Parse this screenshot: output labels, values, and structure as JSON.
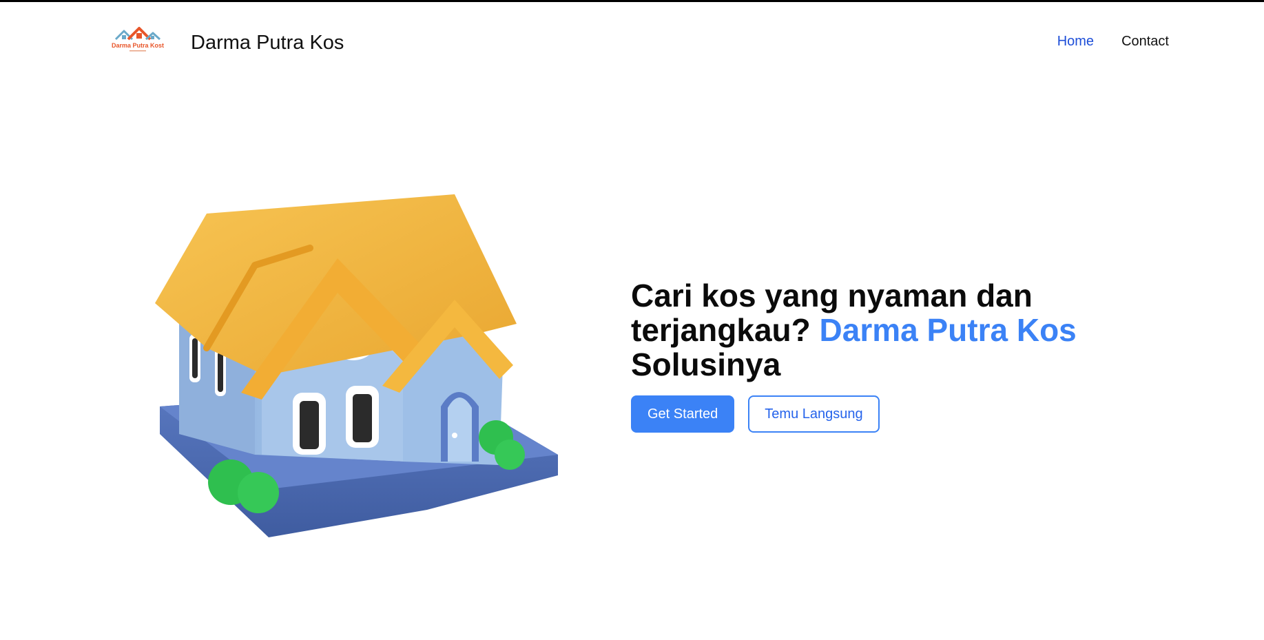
{
  "header": {
    "brand_name": "Darma Putra Kos",
    "logo_text": "Darma Putra Kost",
    "nav": [
      {
        "label": "Home",
        "active": true
      },
      {
        "label": "Contact",
        "active": false
      }
    ]
  },
  "hero": {
    "headline_part1": "Cari kos yang nyaman dan terjangkau?",
    "headline_accent": "Darma Putra Kos",
    "headline_part2": "Solusinya",
    "primary_cta": "Get Started",
    "secondary_cta": "Temu Langsung"
  },
  "colors": {
    "accent": "#3b82f6",
    "nav_active": "#1d4ed8",
    "roof": "#f3b73e",
    "wall": "#a9c8ea",
    "base": "#4f6db5",
    "bush": "#2fbf4f"
  },
  "icons": {
    "logo": "house-roof-logo",
    "hero": "house-illustration"
  }
}
